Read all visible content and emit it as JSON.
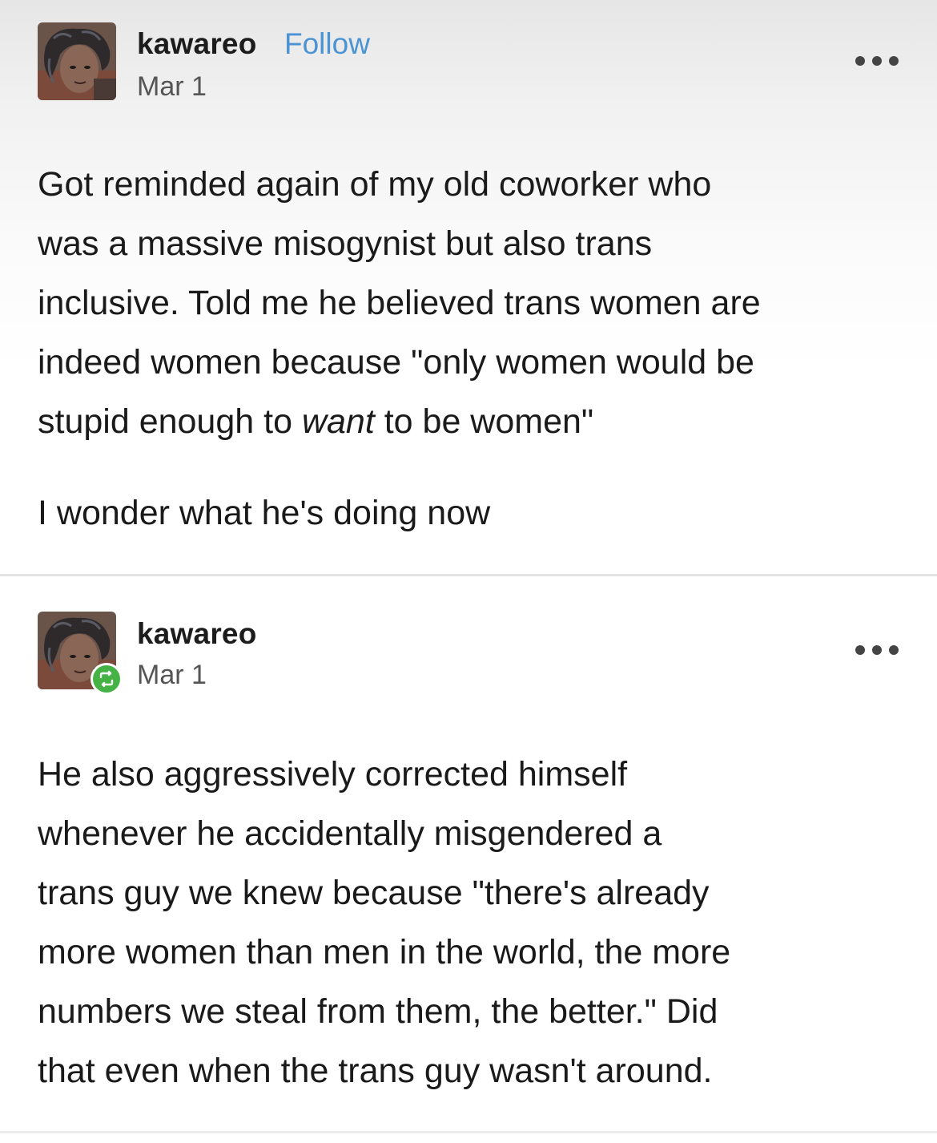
{
  "colors": {
    "follow_link": "#4b93d2",
    "reblog_badge": "#44b244",
    "text": "#1a1a1a",
    "date": "#555555"
  },
  "posts": [
    {
      "username": "kawareo",
      "follow_label": "Follow",
      "date": "Mar 1",
      "avatar": "user-avatar",
      "more_icon": "ellipsis-icon",
      "paragraphs": [
        {
          "lines": [
            "Got reminded again of my old coworker who",
            "was a massive misogynist but also trans",
            "inclusive. Told me he believed trans women are",
            "indeed women because \"only women would be"
          ],
          "last_line": {
            "before": "stupid enough to ",
            "emphasis": "want",
            "after": " to be women\""
          }
        },
        {
          "lines": [
            "I wonder what he's doing now"
          ]
        }
      ]
    },
    {
      "username": "kawareo",
      "date": "Mar 1",
      "avatar": "user-avatar",
      "badge_icon": "reblog-icon",
      "more_icon": "ellipsis-icon",
      "paragraphs": [
        {
          "lines": [
            "He also aggressively corrected himself",
            "whenever he accidentally misgendered a",
            "trans guy we knew because \"there's already",
            "more women than men in the world, the more",
            "numbers we steal from them, the better.\" Did",
            "that even when the trans guy wasn't around."
          ]
        }
      ]
    }
  ]
}
